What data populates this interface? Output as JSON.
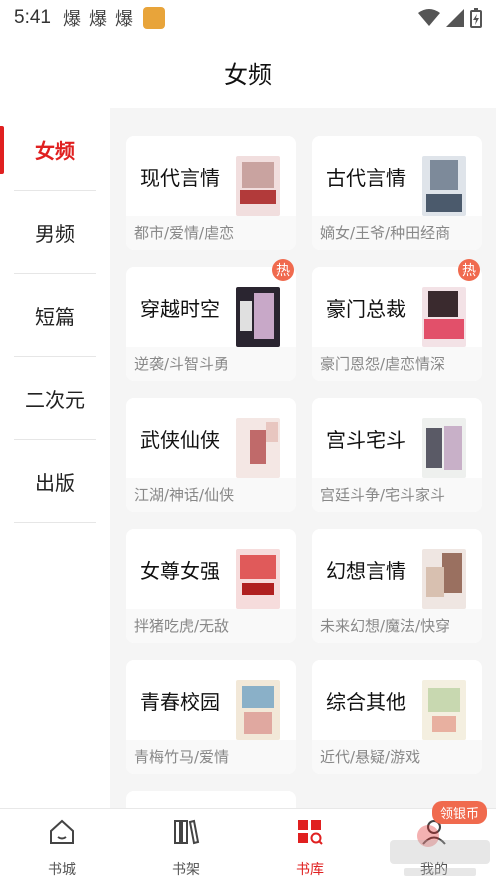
{
  "status": {
    "time": "5:41",
    "notif_glyphs": [
      "爆",
      "爆",
      "爆"
    ]
  },
  "header": {
    "title": "女频"
  },
  "sidebar": {
    "items": [
      {
        "label": "女频",
        "active": true
      },
      {
        "label": "男频",
        "active": false
      },
      {
        "label": "短篇",
        "active": false
      },
      {
        "label": "二次元",
        "active": false
      },
      {
        "label": "出版",
        "active": false
      }
    ]
  },
  "categories": [
    {
      "name": "现代言情",
      "tags": "都市/爱情/虐恋",
      "hot": false,
      "cover": "cover-a"
    },
    {
      "name": "古代言情",
      "tags": "嫡女/王爷/种田经商",
      "hot": false,
      "cover": "cover-b"
    },
    {
      "name": "穿越时空",
      "tags": "逆袭/斗智斗勇",
      "hot": true,
      "badge": "热",
      "cover": "cover-c"
    },
    {
      "name": "豪门总裁",
      "tags": "豪门恩怨/虐恋情深",
      "hot": true,
      "badge": "热",
      "cover": "cover-d"
    },
    {
      "name": "武侠仙侠",
      "tags": "江湖/神话/仙侠",
      "hot": false,
      "cover": "cover-e"
    },
    {
      "name": "宫斗宅斗",
      "tags": "宫廷斗争/宅斗家斗",
      "hot": false,
      "cover": "cover-f"
    },
    {
      "name": "女尊女强",
      "tags": "拌猪吃虎/无敌",
      "hot": false,
      "cover": "cover-g"
    },
    {
      "name": "幻想言情",
      "tags": "未来幻想/魔法/快穿",
      "hot": false,
      "cover": "cover-h"
    },
    {
      "name": "青春校园",
      "tags": "青梅竹马/爱情",
      "hot": false,
      "cover": "cover-i"
    },
    {
      "name": "综合其他",
      "tags": "近代/悬疑/游戏",
      "hot": false,
      "cover": "cover-j"
    }
  ],
  "tabbar": {
    "items": [
      {
        "label": "书城",
        "icon": "home-icon",
        "active": false
      },
      {
        "label": "书架",
        "icon": "bookshelf-icon",
        "active": false
      },
      {
        "label": "书库",
        "icon": "library-icon",
        "active": true
      },
      {
        "label": "我的",
        "icon": "profile-icon",
        "active": false
      }
    ],
    "coin_badge": "领银币"
  },
  "colors": {
    "accent": "#e02020",
    "badge": "#f06a4e",
    "content_bg": "#f5f5f5"
  }
}
